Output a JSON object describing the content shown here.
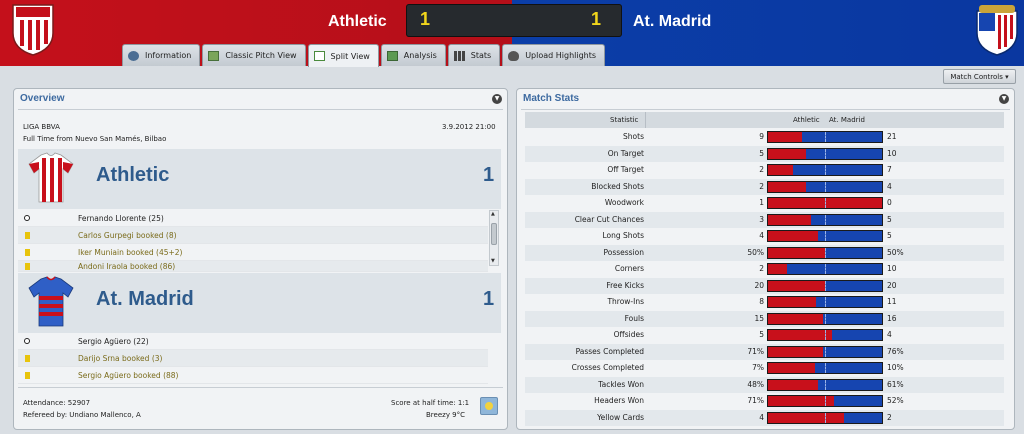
{
  "header": {
    "home_team": "Athletic",
    "away_team": "At. Madrid",
    "home_score": "1",
    "away_score": "1",
    "home_color": "#c4101b",
    "away_color": "#0b3ea8"
  },
  "tabs": [
    {
      "label": "Information",
      "icon": "info-icon"
    },
    {
      "label": "Classic Pitch View",
      "icon": "pitch-icon"
    },
    {
      "label": "Split View",
      "icon": "split-view-icon",
      "active": true
    },
    {
      "label": "Analysis",
      "icon": "analysis-icon"
    },
    {
      "label": "Stats",
      "icon": "stats-icon"
    },
    {
      "label": "Upload Highlights",
      "icon": "upload-icon"
    }
  ],
  "match_controls": "Match Controls",
  "overview": {
    "title": "Overview",
    "competition": "LIGA BBVA",
    "kickoff": "3.9.2012 21:00",
    "status": "Full Time from Nuevo San Mamés, Bilbao",
    "home": {
      "name": "Athletic",
      "score": "1",
      "events": [
        {
          "type": "goal",
          "text": "Fernando Llorente (25)"
        },
        {
          "type": "booking",
          "text": "Carlos Gurpegi booked (8)"
        },
        {
          "type": "booking",
          "text": "Iker Muniain booked (45+2)"
        },
        {
          "type": "booking",
          "text": "Andoni Iraola booked (86)"
        }
      ]
    },
    "away": {
      "name": "At. Madrid",
      "score": "1",
      "events": [
        {
          "type": "goal",
          "text": "Sergio Agüero (22)"
        },
        {
          "type": "booking",
          "text": "Darijo Srna booked (3)"
        },
        {
          "type": "booking",
          "text": "Sergio Agüero booked (88)"
        }
      ]
    },
    "attendance": "Attendance: 52907",
    "referee": "Refereed by: Undiano Mallenco, A",
    "half_time": "Score at half time: 1:1",
    "weather": "Breezy 9°C"
  },
  "match_stats": {
    "title": "Match Stats",
    "columns": {
      "statistic": "Statistic",
      "home": "Athletic",
      "away": "At. Madrid"
    },
    "rows": [
      {
        "name": "Shots",
        "home": "9",
        "away": "21",
        "share": 0.3
      },
      {
        "name": "On Target",
        "home": "5",
        "away": "10",
        "share": 0.33
      },
      {
        "name": "Off Target",
        "home": "2",
        "away": "7",
        "share": 0.22
      },
      {
        "name": "Blocked Shots",
        "home": "2",
        "away": "4",
        "share": 0.33
      },
      {
        "name": "Woodwork",
        "home": "1",
        "away": "0",
        "share": 1.0
      },
      {
        "name": "Clear Cut Chances",
        "home": "3",
        "away": "5",
        "share": 0.375
      },
      {
        "name": "Long Shots",
        "home": "4",
        "away": "5",
        "share": 0.44
      },
      {
        "name": "Possession",
        "home": "50%",
        "away": "50%",
        "share": 0.5
      },
      {
        "name": "Corners",
        "home": "2",
        "away": "10",
        "share": 0.17
      },
      {
        "name": "Free Kicks",
        "home": "20",
        "away": "20",
        "share": 0.5
      },
      {
        "name": "Throw-Ins",
        "home": "8",
        "away": "11",
        "share": 0.42
      },
      {
        "name": "Fouls",
        "home": "15",
        "away": "16",
        "share": 0.48
      },
      {
        "name": "Offsides",
        "home": "5",
        "away": "4",
        "share": 0.56
      },
      {
        "name": "Passes Completed",
        "home": "71%",
        "away": "76%",
        "share": 0.48
      },
      {
        "name": "Crosses Completed",
        "home": "7%",
        "away": "10%",
        "share": 0.41
      },
      {
        "name": "Tackles Won",
        "home": "48%",
        "away": "61%",
        "share": 0.44
      },
      {
        "name": "Headers Won",
        "home": "71%",
        "away": "52%",
        "share": 0.58
      },
      {
        "name": "Yellow Cards",
        "home": "4",
        "away": "2",
        "share": 0.67
      }
    ]
  }
}
